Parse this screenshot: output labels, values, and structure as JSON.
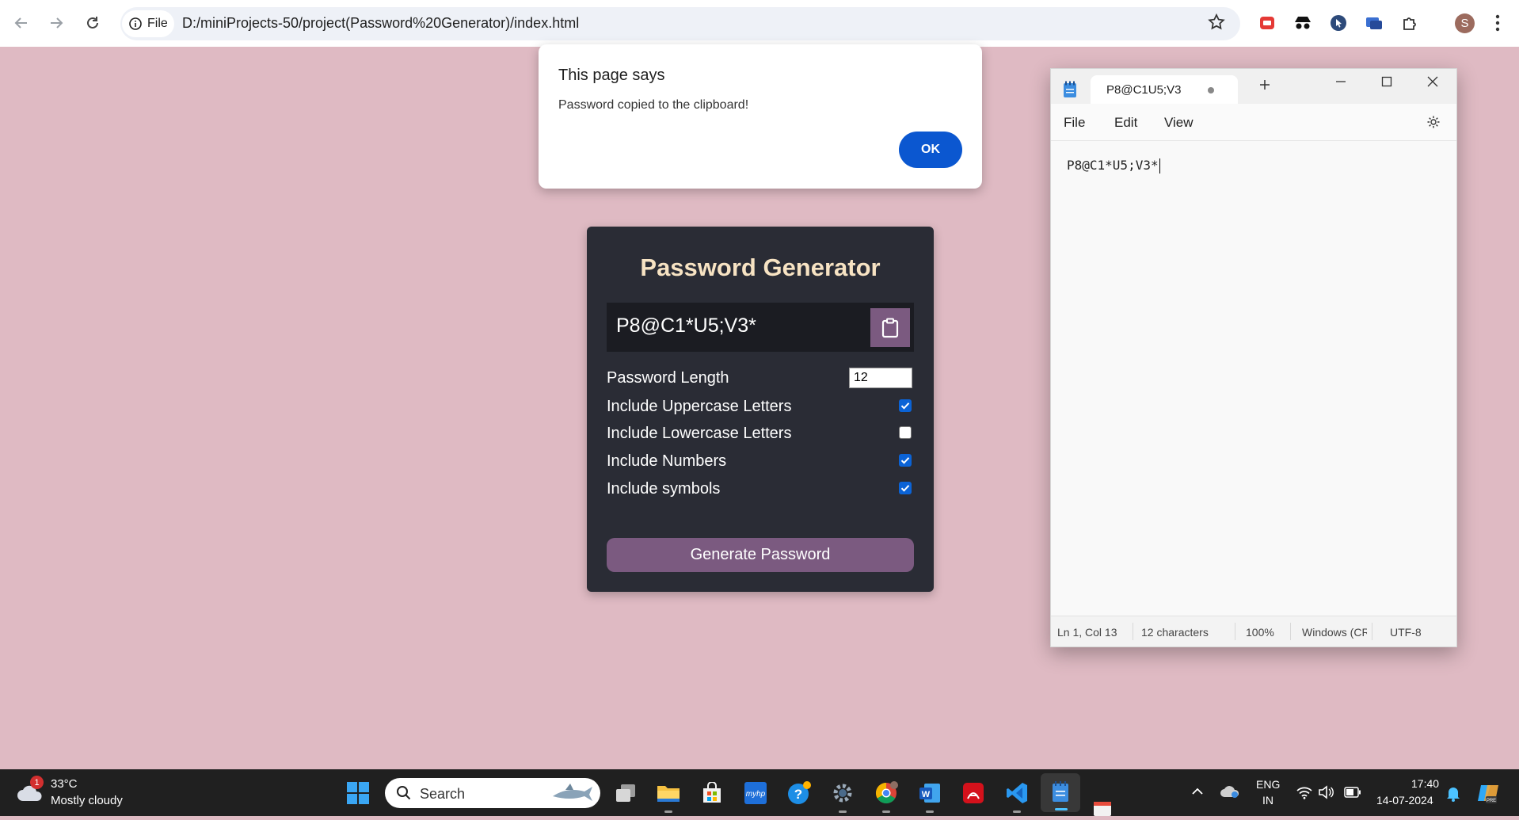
{
  "browser": {
    "site_chip_label": "File",
    "url": "D:/miniProjects-50/project(Password%20Generator)/index.html",
    "profile_initial": "S"
  },
  "dialog": {
    "title": "This page says",
    "message": "Password copied to the clipboard!",
    "ok_label": "OK"
  },
  "generator": {
    "title": "Password Generator",
    "password": "P8@C1*U5;V3*",
    "length_label": "Password Length",
    "length_value": "12",
    "options": [
      {
        "label": "Include Uppercase Letters",
        "checked": true
      },
      {
        "label": "Include Lowercase Letters",
        "checked": false
      },
      {
        "label": "Include Numbers",
        "checked": true
      },
      {
        "label": "Include symbols",
        "checked": true
      }
    ],
    "generate_label": "Generate Password"
  },
  "notepad": {
    "tab_title": "P8@C1U5;V3",
    "menu": {
      "file": "File",
      "edit": "Edit",
      "view": "View"
    },
    "content": "P8@C1*U5;V3*",
    "status": {
      "position": "Ln 1, Col 13",
      "chars": "12 characters",
      "zoom": "100%",
      "line_ending": "Windows (CR",
      "encoding": "UTF-8"
    }
  },
  "taskbar": {
    "weather_temp": "33°C",
    "weather_desc": "Mostly cloudy",
    "weather_badge": "1",
    "search_label": "Search",
    "lang_top": "ENG",
    "lang_bottom": "IN",
    "time": "17:40",
    "date": "14-07-2024"
  },
  "colors": {
    "page_background": "#dfbac3",
    "card": "#2a2c35",
    "accent_purple": "#7b5a80",
    "dialog_ok": "#0b57d0",
    "title_cream": "#f7e3c3"
  }
}
